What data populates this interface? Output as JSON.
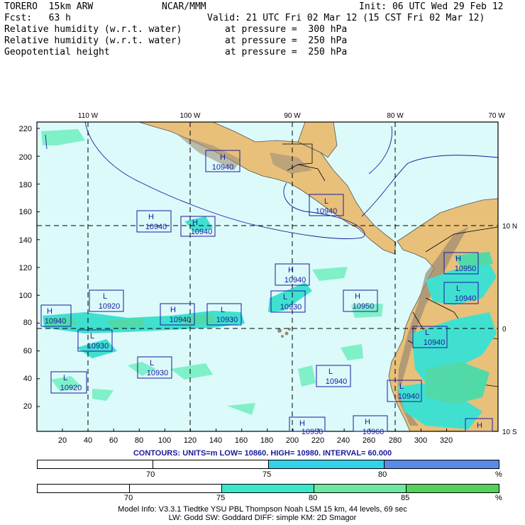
{
  "header": {
    "model": "TORERO  15km ARW",
    "center": "NCAR/MMM",
    "init": "Init: 06 UTC Wed 29 Feb 12",
    "fcst": "Fcst:   63 h",
    "valid": "Valid: 21 UTC Fri 02 Mar 12 (15 CST Fri 02 Mar 12)",
    "fields": [
      {
        "name": "Relative humidity (w.r.t. water)",
        "level": "at pressure =  300 hPa",
        "color": "#1a7f1a"
      },
      {
        "name": "Relative humidity (w.r.t. water)",
        "level": "at pressure =  250 hPa",
        "color": "#1a1aa0"
      },
      {
        "name": "Geopotential height",
        "level": "at pressure =  250 hPa",
        "color": "#1a1aa0"
      }
    ]
  },
  "map": {
    "lon_labels": [
      "110 W",
      "100 W",
      "90 W",
      "80 W",
      "70 W"
    ],
    "lat_labels": [
      "10 N",
      "0",
      "10 S"
    ],
    "y_ticks": [
      "220",
      "200",
      "180",
      "160",
      "140",
      "120",
      "100",
      "80",
      "60",
      "40",
      "20"
    ],
    "x_ticks": [
      "20",
      "40",
      "60",
      "80",
      "100",
      "120",
      "140",
      "160",
      "180",
      "200",
      "220",
      "240",
      "260",
      "280",
      "300",
      "320"
    ],
    "colors": {
      "ocean": "#dcfafa",
      "land": "#e8c07a",
      "rh300_light": "#7ff0c8",
      "rh300_mid": "#52d9a8",
      "rh250": "#40e0d0"
    },
    "centers": [
      {
        "type": "H",
        "value": "10940"
      },
      {
        "type": "L",
        "value": "10940"
      },
      {
        "type": "H",
        "value": "10940"
      },
      {
        "type": "H",
        "value": "10940"
      },
      {
        "type": "H",
        "value": "10940"
      },
      {
        "type": "H",
        "value": "10950"
      },
      {
        "type": "L",
        "value": "10940"
      },
      {
        "type": "H",
        "value": "10940"
      },
      {
        "type": "L",
        "value": "10920"
      },
      {
        "type": "H",
        "value": "10940"
      },
      {
        "type": "L",
        "value": "10930"
      },
      {
        "type": "L",
        "value": "10930"
      },
      {
        "type": "H",
        "value": "10950"
      },
      {
        "type": "L",
        "value": "10930"
      },
      {
        "type": "L",
        "value": "10940"
      },
      {
        "type": "L",
        "value": "10930"
      },
      {
        "type": "L",
        "value": "10920"
      },
      {
        "type": "L",
        "value": "10940"
      },
      {
        "type": "L",
        "value": "10940"
      },
      {
        "type": "H",
        "value": "10950"
      },
      {
        "type": "H",
        "value": "10960"
      },
      {
        "type": "H",
        "value": ""
      }
    ]
  },
  "contours": "CONTOURS:  UNITS=m  LOW=  10860.      HIGH=  10980.      INTERVAL=  60.000",
  "legend250": {
    "labels": [
      "70",
      "75",
      "80",
      "%"
    ],
    "colors": [
      "#ffffff",
      "#ffffff",
      "#34d2e8",
      "#5a8ae8"
    ]
  },
  "legend300": {
    "labels": [
      "70",
      "75",
      "80",
      "85",
      "%"
    ],
    "colors": [
      "#ffffff",
      "#ffffff",
      "#3ae8c8",
      "#6ce8a0",
      "#55d05a"
    ]
  },
  "footer": {
    "line1": "Model Info: V3.3.1    Tiedtke YSU PBL  Thompson    Noah LSM  15 km,   44 levels,   69 sec",
    "line2": "LW: Godd SW: Goddard DIFF: simple KM: 2D Smagor"
  }
}
